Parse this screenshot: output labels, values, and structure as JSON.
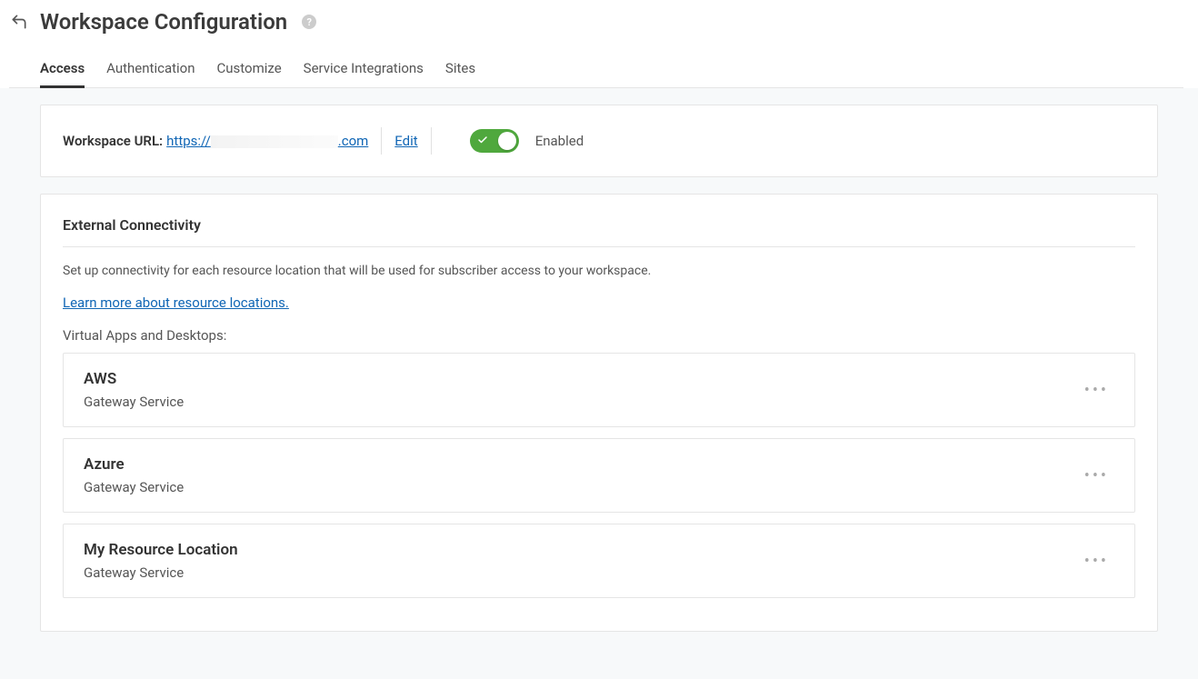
{
  "page": {
    "title": "Workspace Configuration"
  },
  "tabs": [
    {
      "label": "Access",
      "active": true
    },
    {
      "label": "Authentication",
      "active": false
    },
    {
      "label": "Customize",
      "active": false
    },
    {
      "label": "Service Integrations",
      "active": false
    },
    {
      "label": "Sites",
      "active": false
    }
  ],
  "url_card": {
    "label": "Workspace URL:",
    "url_prefix": "https://",
    "url_suffix": ".com",
    "edit": "Edit",
    "toggle_state": "Enabled"
  },
  "connectivity": {
    "title": "External Connectivity",
    "description": "Set up connectivity for each resource location that will be used for subscriber access to your workspace.",
    "learn_more": "Learn more about resource locations.",
    "subsection": "Virtual Apps and Desktops:",
    "resources": [
      {
        "name": "AWS",
        "sub": "Gateway Service"
      },
      {
        "name": "Azure",
        "sub": "Gateway Service"
      },
      {
        "name": "My Resource Location",
        "sub": "Gateway Service"
      }
    ]
  }
}
